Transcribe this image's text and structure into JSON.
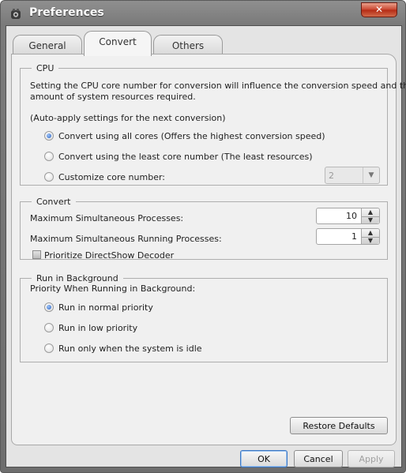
{
  "window": {
    "title": "Preferences",
    "close_glyph": "✕",
    "icon": "app-icon"
  },
  "tabs": [
    {
      "label": "General"
    },
    {
      "label": "Convert"
    },
    {
      "label": "Others"
    }
  ],
  "cpu": {
    "legend": "CPU",
    "description_line1": "Setting the CPU core number for conversion will influence the conversion speed and the",
    "description_line2": "amount of system resources required.",
    "note": "(Auto-apply settings for the next conversion)",
    "options": [
      {
        "label": "Convert using all cores (Offers the highest conversion speed)",
        "selected": true
      },
      {
        "label": "Convert using the least core number (The least resources)",
        "selected": false
      },
      {
        "label": "Customize core number:",
        "selected": false
      }
    ],
    "core_number": {
      "value": "2",
      "enabled": false
    }
  },
  "convert": {
    "legend": "Convert",
    "max_processes_label": "Maximum Simultaneous Processes:",
    "max_processes_value": "10",
    "max_running_label": "Maximum Simultaneous Running Processes:",
    "max_running_value": "1",
    "directshow_label": "Prioritize DirectShow Decoder",
    "directshow_checked": false
  },
  "background": {
    "legend": "Run in Background",
    "priority_label": "Priority When Running in Background:",
    "options": [
      {
        "label": "Run in normal priority",
        "selected": true
      },
      {
        "label": "Run in low priority",
        "selected": false
      },
      {
        "label": "Run only when the system is idle",
        "selected": false
      }
    ]
  },
  "buttons": {
    "restore_defaults": "Restore Defaults",
    "ok": "OK",
    "cancel": "Cancel",
    "apply": "Apply"
  },
  "colors": {
    "accent": "#2a64c6",
    "close_button": "#c8432c"
  }
}
